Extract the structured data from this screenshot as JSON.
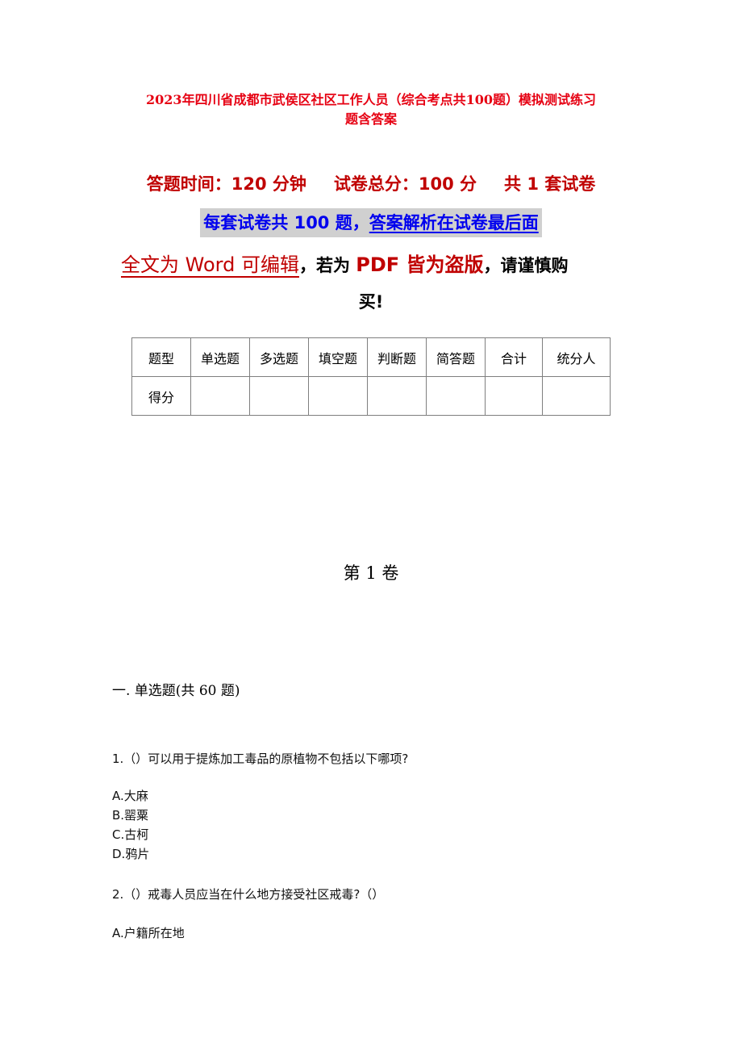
{
  "document": {
    "title_line1": "2023年四川省成都市武侯区社区工作人员（综合考点共100题）模拟测试练习",
    "title_line2": "题含答案",
    "exam_info": {
      "time": "答题时间：120 分钟",
      "total_score": "试卷总分：100 分",
      "sets": "共 1 套试卷"
    },
    "notice": {
      "part1": "每套试卷共 100 题，",
      "part2": "答案解析在试卷最后面"
    },
    "warning": {
      "part1": "全文为 Word 可编辑",
      "comma1": "，若为 ",
      "part2": "PDF 皆为盗版",
      "part3": "，请谨慎购",
      "part4": "买!"
    },
    "score_table": {
      "header": [
        "题型",
        "单选题",
        "多选题",
        "填空题",
        "判断题",
        "简答题",
        "合计",
        "统分人"
      ],
      "row": [
        "得分",
        "",
        "",
        "",
        "",
        "",
        "",
        ""
      ]
    },
    "volume_title": "第 1 卷",
    "section_title": "一. 单选题(共 60 题)",
    "questions": [
      {
        "text": "1.（）可以用于提炼加工毒品的原植物不包括以下哪项?",
        "options": [
          "A.大麻",
          "B.罂粟",
          "C.古柯",
          "D.鸦片"
        ]
      },
      {
        "text": "2.（）戒毒人员应当在什么地方接受社区戒毒?（）",
        "options": [
          "A.户籍所在地"
        ]
      }
    ]
  },
  "colors": {
    "title_red": "#e60012",
    "info_red": "#c00000",
    "notice_blue": "#0000ee",
    "notice_bg": "#d0d0d0"
  }
}
